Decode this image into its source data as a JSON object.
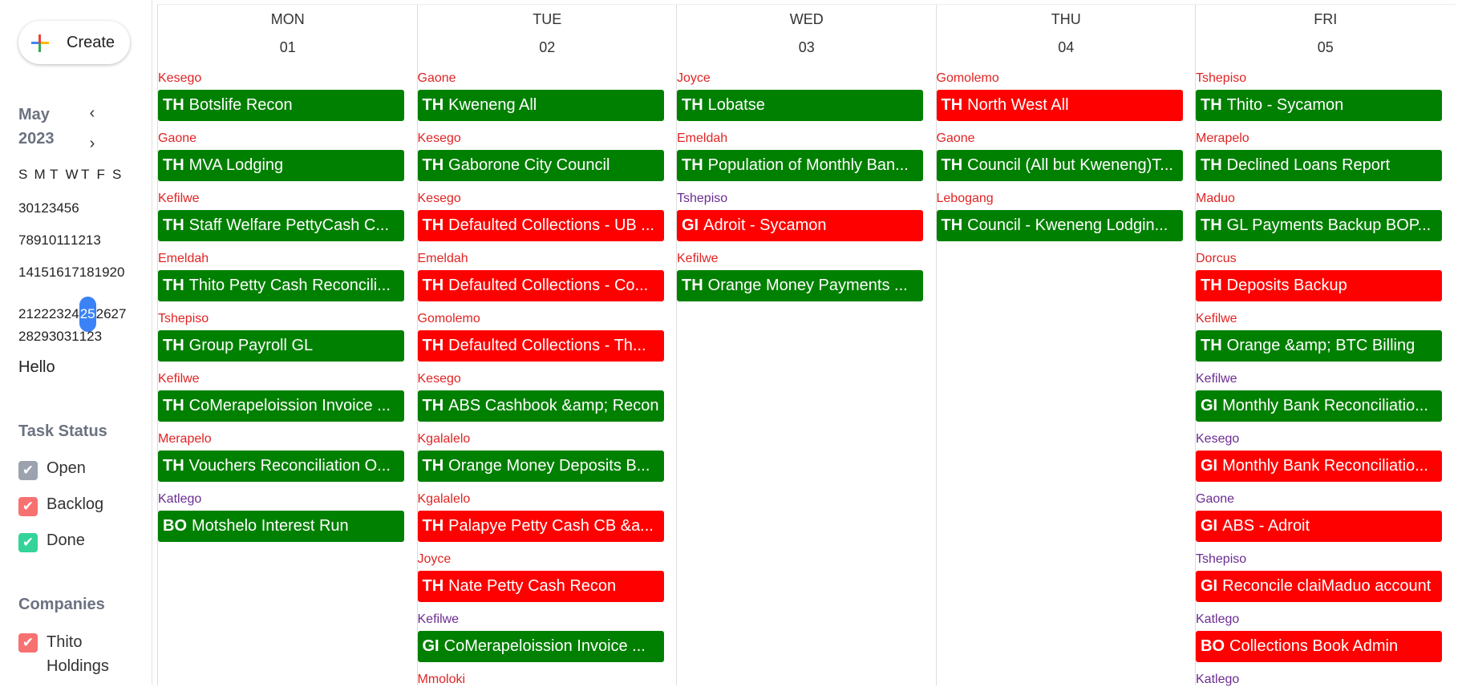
{
  "colors": {
    "green": "#008000",
    "red": "#ff0000",
    "owner_red": "#e02424",
    "owner_purple": "#6b2c91",
    "accent_blue": "#3b82f6",
    "open_gray": "#9ca3af",
    "backlog_red": "#f87171",
    "done_green": "#34d399"
  },
  "create": {
    "label": "Create",
    "icon": "multicolor-plus-icon"
  },
  "mini_calendar": {
    "title": "May 2023",
    "prev_icon": "chevron-left-icon",
    "next_icon": "chevron-right-icon",
    "prev": "‹",
    "next": "›",
    "weekdays": [
      "S",
      "M",
      "T",
      "W",
      "T",
      "F",
      "S"
    ],
    "weeks": [
      [
        "30",
        "1",
        "2",
        "3",
        "4",
        "5",
        "6"
      ],
      [
        "7",
        "8",
        "9",
        "10",
        "11",
        "12",
        "13"
      ],
      [
        "14",
        "15",
        "16",
        "17",
        "18",
        "19",
        "20"
      ],
      [
        "21",
        "22",
        "23",
        "24",
        "25",
        "26",
        "27"
      ],
      [
        "28",
        "29",
        "30",
        "31",
        "1",
        "2",
        "3"
      ]
    ],
    "today": "25"
  },
  "hello": "Hello",
  "task_status": {
    "title": "Task Status",
    "items": [
      {
        "label": "Open",
        "checked": true,
        "color": "#9ca3af"
      },
      {
        "label": "Backlog",
        "checked": true,
        "color": "#f87171"
      },
      {
        "label": "Done",
        "checked": true,
        "color": "#34d399"
      }
    ]
  },
  "companies": {
    "title": "Companies",
    "items": [
      {
        "label": "Thito Holdings",
        "checked": true,
        "color": "#f87171"
      }
    ]
  },
  "days": [
    {
      "name": "MON",
      "date": "01",
      "tasks": [
        {
          "owner": "Kesego",
          "owner_color": "red",
          "code": "TH",
          "title": "Botslife Recon",
          "status": "green"
        },
        {
          "owner": "Gaone",
          "owner_color": "red",
          "code": "TH",
          "title": "MVA Lodging",
          "status": "green"
        },
        {
          "owner": "Kefilwe",
          "owner_color": "red",
          "code": "TH",
          "title": "Staff Welfare PettyCash C...",
          "status": "green"
        },
        {
          "owner": "Emeldah",
          "owner_color": "red",
          "code": "TH",
          "title": "Thito Petty Cash Reconcili...",
          "status": "green"
        },
        {
          "owner": "Tshepiso",
          "owner_color": "red",
          "code": "TH",
          "title": "Group Payroll GL",
          "status": "green"
        },
        {
          "owner": "Kefilwe",
          "owner_color": "red",
          "code": "TH",
          "title": "CoMerapeloission Invoice ...",
          "status": "green"
        },
        {
          "owner": "Merapelo",
          "owner_color": "red",
          "code": "TH",
          "title": "Vouchers Reconciliation O...",
          "status": "green"
        },
        {
          "owner": "Katlego",
          "owner_color": "purple",
          "code": "BO",
          "title": "Motshelo Interest Run",
          "status": "green"
        }
      ]
    },
    {
      "name": "TUE",
      "date": "02",
      "tasks": [
        {
          "owner": "Gaone",
          "owner_color": "red",
          "code": "TH",
          "title": "Kweneng All",
          "status": "green"
        },
        {
          "owner": "Kesego",
          "owner_color": "red",
          "code": "TH",
          "title": "Gaborone City Council",
          "status": "green"
        },
        {
          "owner": "Kesego",
          "owner_color": "red",
          "code": "TH",
          "title": "Defaulted Collections - UB ...",
          "status": "red"
        },
        {
          "owner": "Emeldah",
          "owner_color": "red",
          "code": "TH",
          "title": "Defaulted Collections - Co...",
          "status": "red"
        },
        {
          "owner": "Gomolemo",
          "owner_color": "red",
          "code": "TH",
          "title": "Defaulted Collections - Th...",
          "status": "red"
        },
        {
          "owner": "Kesego",
          "owner_color": "red",
          "code": "TH",
          "title": "ABS Cashbook &amp; Recon",
          "status": "green"
        },
        {
          "owner": "Kgalalelo",
          "owner_color": "red",
          "code": "TH",
          "title": "Orange Money Deposits B...",
          "status": "green"
        },
        {
          "owner": "Kgalalelo",
          "owner_color": "red",
          "code": "TH",
          "title": "Palapye Petty Cash CB &a...",
          "status": "red"
        },
        {
          "owner": "Joyce",
          "owner_color": "red",
          "code": "TH",
          "title": "Nate Petty Cash Recon",
          "status": "red"
        },
        {
          "owner": "Kefilwe",
          "owner_color": "purple",
          "code": "GI",
          "title": "CoMerapeloission Invoice ...",
          "status": "green"
        },
        {
          "owner": "Mmoloki",
          "owner_color": "red",
          "code": "",
          "title": "",
          "status": ""
        }
      ]
    },
    {
      "name": "WED",
      "date": "03",
      "tasks": [
        {
          "owner": "Joyce",
          "owner_color": "red",
          "code": "TH",
          "title": "Lobatse",
          "status": "green"
        },
        {
          "owner": "Emeldah",
          "owner_color": "red",
          "code": "TH",
          "title": "Population of Monthly Ban...",
          "status": "green"
        },
        {
          "owner": "Tshepiso",
          "owner_color": "purple",
          "code": "GI",
          "title": "Adroit - Sycamon",
          "status": "red"
        },
        {
          "owner": "Kefilwe",
          "owner_color": "red",
          "code": "TH",
          "title": "Orange Money Payments ...",
          "status": "green"
        }
      ]
    },
    {
      "name": "THU",
      "date": "04",
      "tasks": [
        {
          "owner": "Gomolemo",
          "owner_color": "red",
          "code": "TH",
          "title": "North West All",
          "status": "red"
        },
        {
          "owner": "Gaone",
          "owner_color": "red",
          "code": "TH",
          "title": "Council (All but Kweneng)T...",
          "status": "green"
        },
        {
          "owner": "Lebogang",
          "owner_color": "red",
          "code": "TH",
          "title": "Council - Kweneng Lodgin...",
          "status": "green"
        }
      ]
    },
    {
      "name": "FRI",
      "date": "05",
      "tasks": [
        {
          "owner": "Tshepiso",
          "owner_color": "red",
          "code": "TH",
          "title": "Thito - Sycamon",
          "status": "green"
        },
        {
          "owner": "Merapelo",
          "owner_color": "red",
          "code": "TH",
          "title": "Declined Loans Report",
          "status": "green"
        },
        {
          "owner": "Maduo",
          "owner_color": "red",
          "code": "TH",
          "title": "GL Payments Backup BOP...",
          "status": "green"
        },
        {
          "owner": "Dorcus",
          "owner_color": "red",
          "code": "TH",
          "title": "Deposits Backup",
          "status": "red"
        },
        {
          "owner": "Kefilwe",
          "owner_color": "red",
          "code": "TH",
          "title": "Orange &amp; BTC Billing",
          "status": "green"
        },
        {
          "owner": "Kefilwe",
          "owner_color": "purple",
          "code": "GI",
          "title": "Monthly Bank Reconciliatio...",
          "status": "green"
        },
        {
          "owner": "Kesego",
          "owner_color": "purple",
          "code": "GI",
          "title": "Monthly Bank Reconciliatio...",
          "status": "red"
        },
        {
          "owner": "Gaone",
          "owner_color": "purple",
          "code": "GI",
          "title": "ABS - Adroit",
          "status": "red"
        },
        {
          "owner": "Tshepiso",
          "owner_color": "purple",
          "code": "GI",
          "title": "Reconcile claiMaduo account",
          "status": "red"
        },
        {
          "owner": "Katlego",
          "owner_color": "purple",
          "code": "BO",
          "title": "Collections Book Admin",
          "status": "red"
        },
        {
          "owner": "Katlego",
          "owner_color": "purple",
          "code": "",
          "title": "",
          "status": ""
        }
      ]
    }
  ]
}
